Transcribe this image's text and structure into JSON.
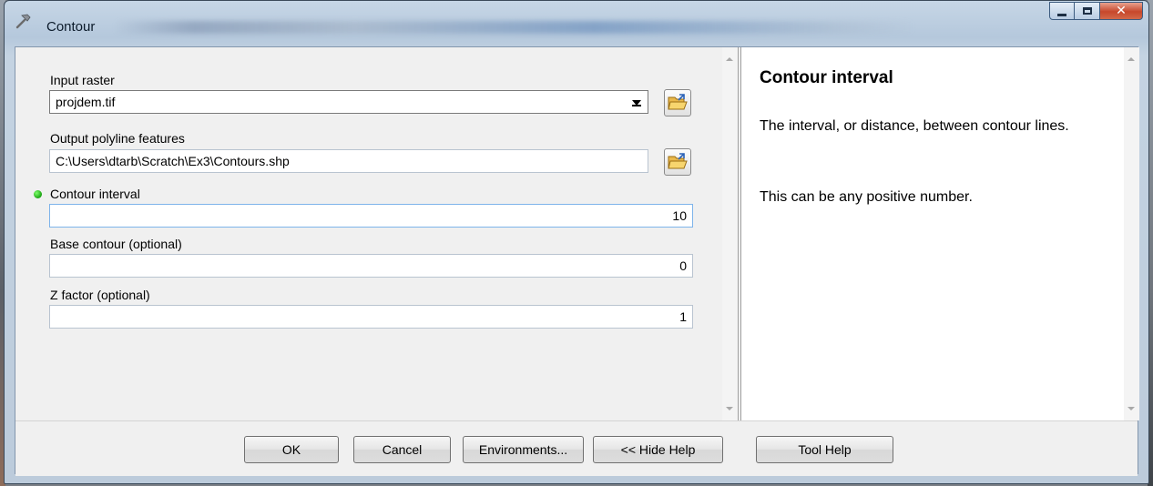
{
  "window": {
    "title": "Contour"
  },
  "form": {
    "input_raster": {
      "label": "Input raster",
      "value": "projdem.tif"
    },
    "output_features": {
      "label": "Output polyline features",
      "value": "C:\\Users\\dtarb\\Scratch\\Ex3\\Contours.shp"
    },
    "contour_interval": {
      "label": "Contour interval",
      "value": "10"
    },
    "base_contour": {
      "label": "Base contour (optional)",
      "value": "0"
    },
    "z_factor": {
      "label": "Z factor (optional)",
      "value": "1"
    }
  },
  "help": {
    "title": "Contour interval",
    "paragraph1": "The interval, or distance, between contour lines.",
    "paragraph2": "This can be any positive number."
  },
  "buttons": {
    "ok": "OK",
    "cancel": "Cancel",
    "environments": "Environments...",
    "hide_help": "<< Hide Help",
    "tool_help": "Tool Help"
  },
  "colors": {
    "required_indicator": "#1aa312",
    "client_background": "#f0f0f0",
    "window_frame": "#b5c8dc"
  },
  "icons": {
    "title": "hammer-icon",
    "browse": "folder-open-icon",
    "required": "green-dot-icon"
  }
}
